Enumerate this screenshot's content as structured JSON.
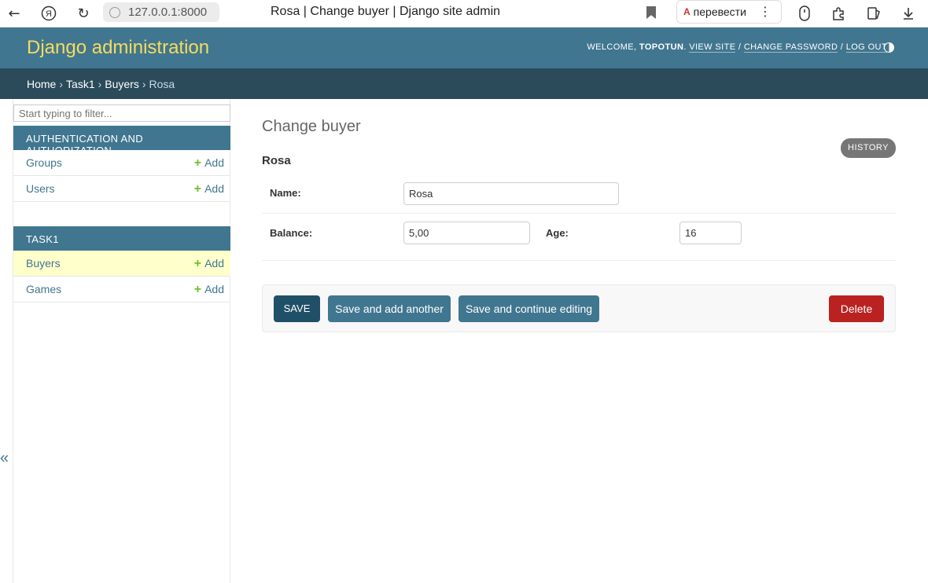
{
  "browser": {
    "url": "127.0.0.1:8000",
    "tab_title": "Rosa | Change buyer | Django site admin",
    "translate_label": "перевести",
    "translate_icon": "A"
  },
  "header": {
    "brand": "Django administration",
    "welcome": "WELCOME,",
    "username": "TOPOTUN",
    "view_site": "VIEW SITE",
    "change_password": "CHANGE PASSWORD",
    "log_out": "LOG OUT"
  },
  "breadcrumbs": {
    "home": "Home",
    "app": "Task1",
    "model": "Buyers",
    "current": "Rosa"
  },
  "sidebar": {
    "filter_placeholder": "Start typing to filter...",
    "apps": [
      {
        "name": "AUTHENTICATION AND AUTHORIZATION",
        "models": [
          {
            "name": "Groups",
            "add": "Add"
          },
          {
            "name": "Users",
            "add": "Add"
          }
        ]
      },
      {
        "name": "TASK1",
        "models": [
          {
            "name": "Buyers",
            "add": "Add"
          },
          {
            "name": "Games",
            "add": "Add"
          }
        ]
      }
    ],
    "collapse_symbol": "«"
  },
  "main": {
    "title": "Change buyer",
    "history": "HISTORY",
    "object_title": "Rosa",
    "fields": {
      "name_label": "Name:",
      "name_value": "Rosa",
      "balance_label": "Balance:",
      "balance_value": "5,00",
      "age_label": "Age:",
      "age_value": "16"
    },
    "buttons": {
      "save": "SAVE",
      "save_add": "Save and add another",
      "save_continue": "Save and continue editing",
      "delete": "Delete"
    }
  },
  "colors": {
    "header": "#417690",
    "breadcrumb": "#2b4b5a",
    "brand": "#f5dd5d",
    "delete": "#ba2121"
  }
}
